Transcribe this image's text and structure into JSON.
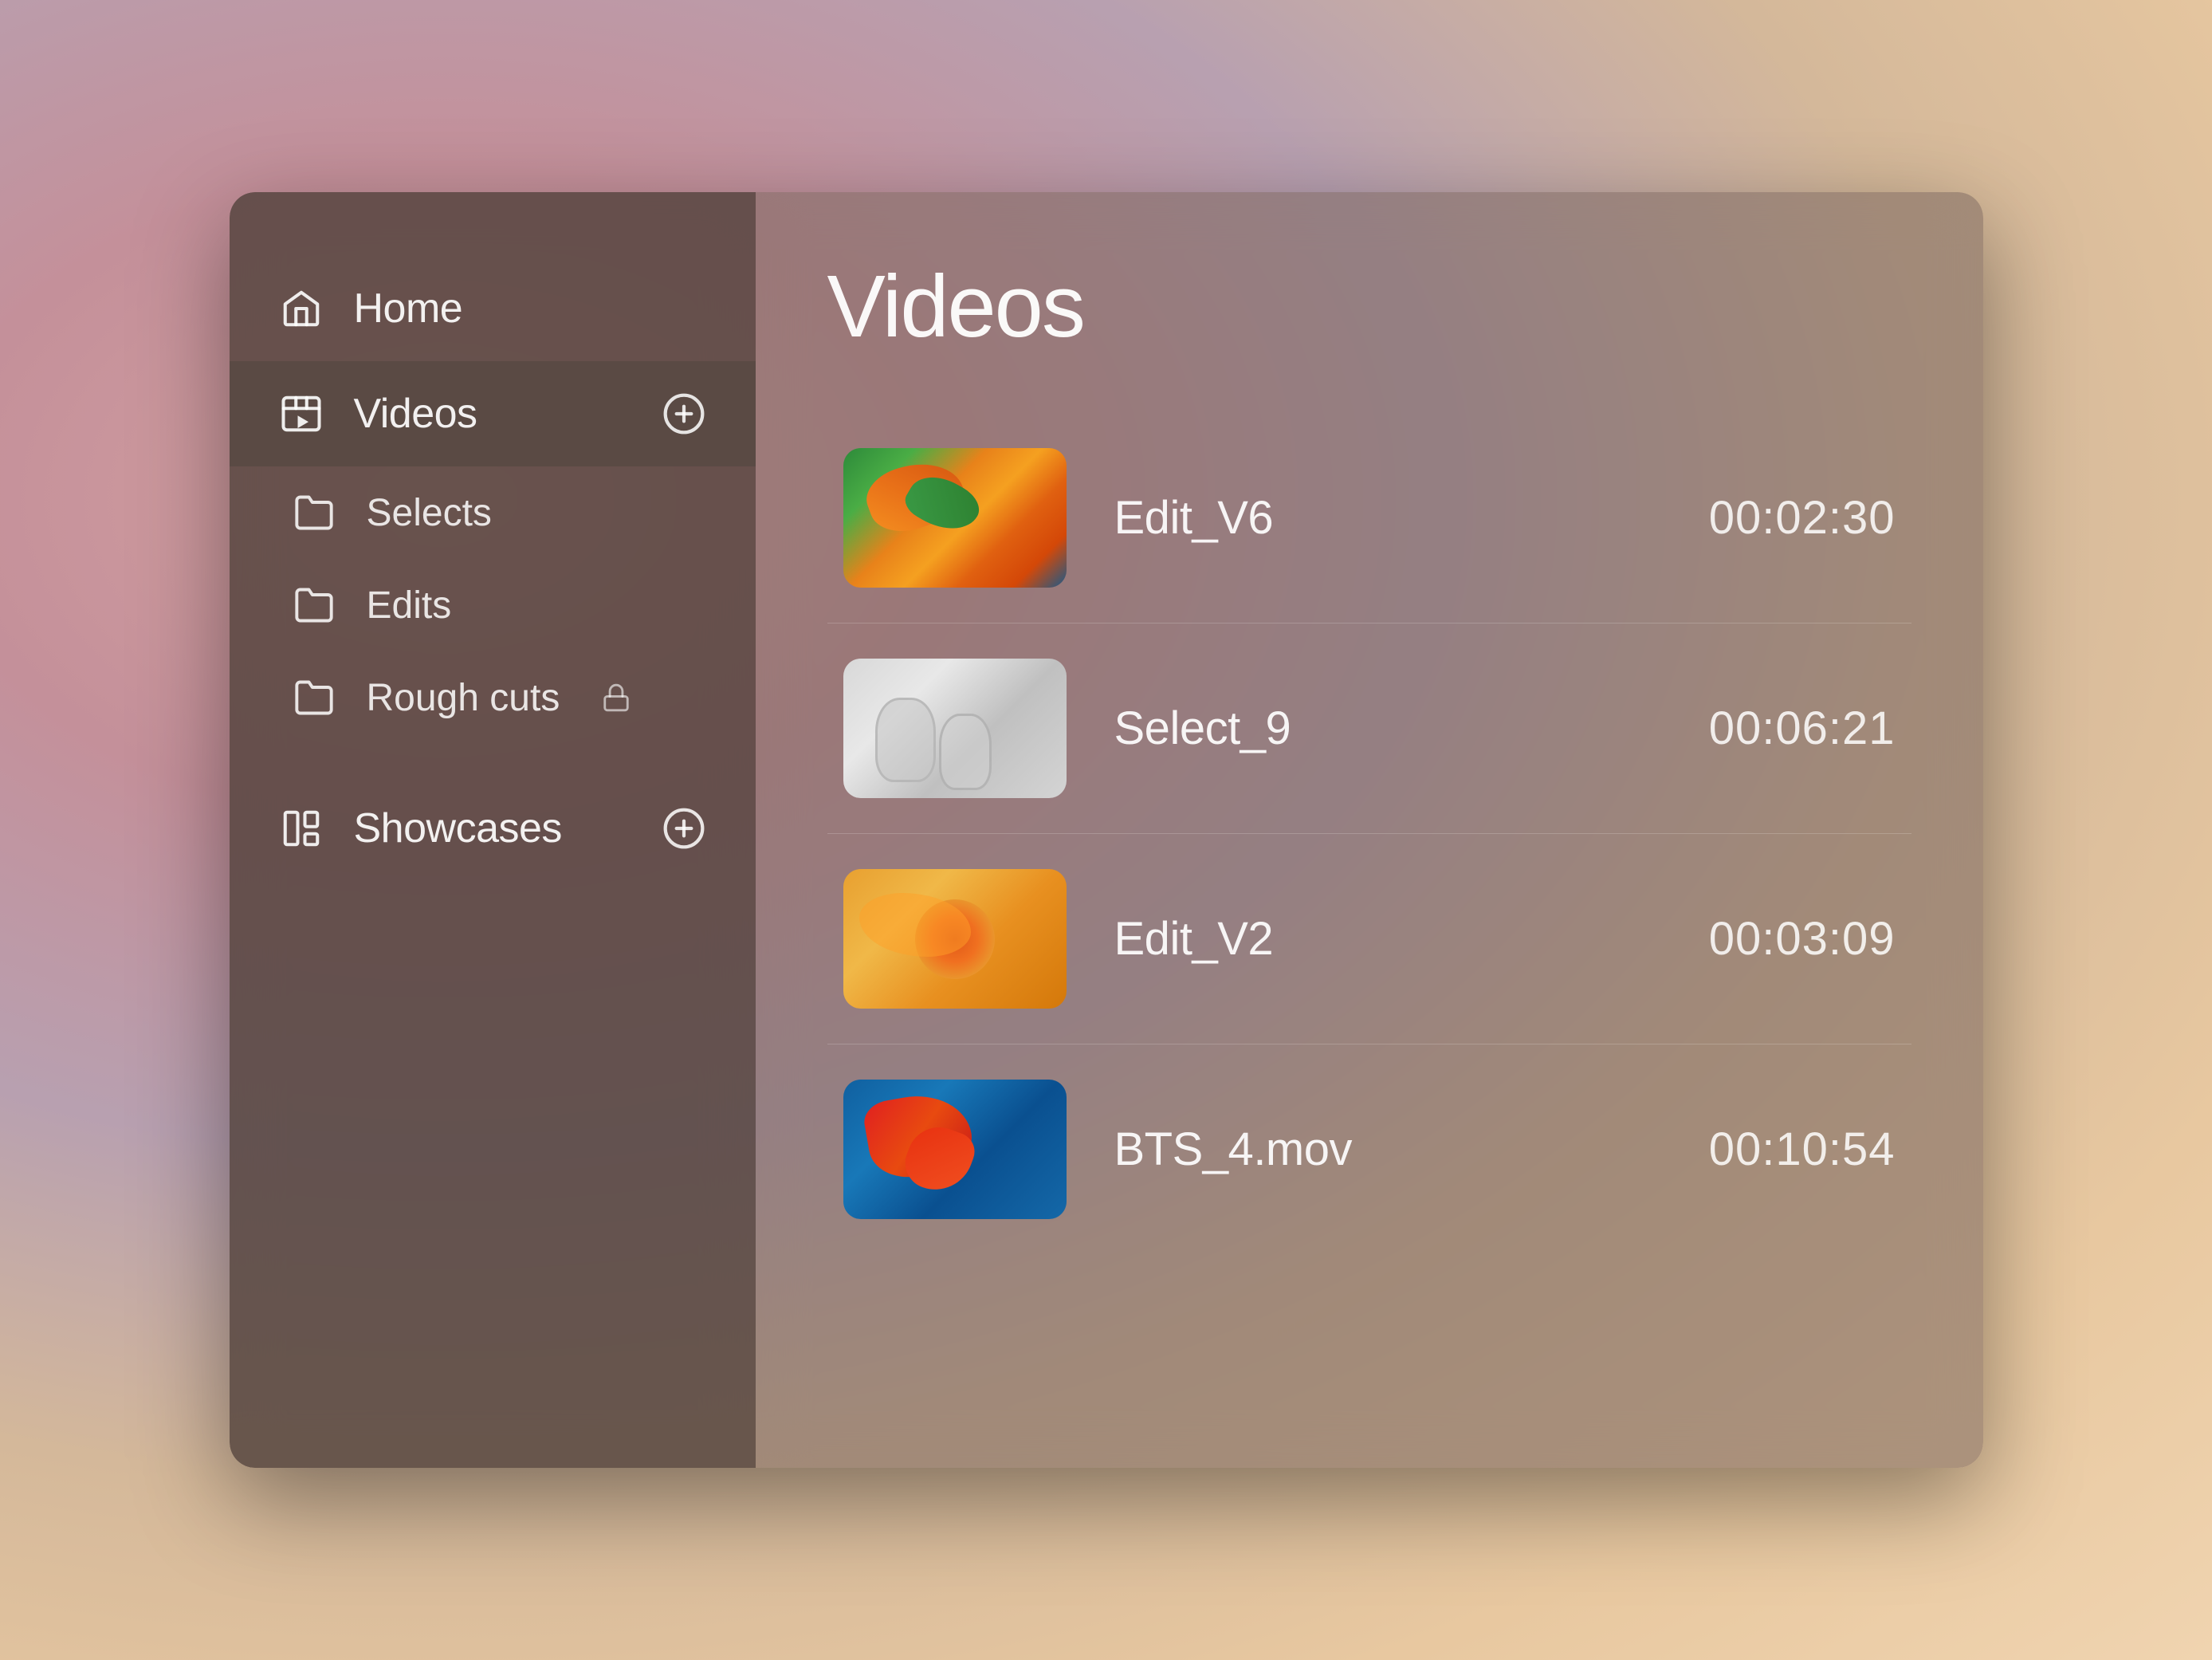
{
  "sidebar": {
    "items": [
      {
        "id": "home",
        "label": "Home",
        "icon": "home-icon",
        "active": false
      },
      {
        "id": "videos",
        "label": "Videos",
        "icon": "video-icon",
        "active": true,
        "addButton": true
      }
    ],
    "folders": [
      {
        "id": "selects",
        "label": "Selects",
        "locked": false
      },
      {
        "id": "edits",
        "label": "Edits",
        "locked": false
      },
      {
        "id": "rough-cuts",
        "label": "Rough cuts",
        "locked": true
      }
    ],
    "showcases": {
      "label": "Showcases",
      "icon": "showcases-icon",
      "addButton": true
    }
  },
  "main": {
    "title": "Videos",
    "videos": [
      {
        "id": "edit_v6",
        "name": "Edit_V6",
        "duration": "00:02:30",
        "thumb": "1"
      },
      {
        "id": "select_9",
        "name": "Select_9",
        "duration": "00:06:21",
        "thumb": "2"
      },
      {
        "id": "edit_v2",
        "name": "Edit_V2",
        "duration": "00:03:09",
        "thumb": "3"
      },
      {
        "id": "bts_4",
        "name": "BTS_4.mov",
        "duration": "00:10:54",
        "thumb": "4"
      }
    ]
  }
}
